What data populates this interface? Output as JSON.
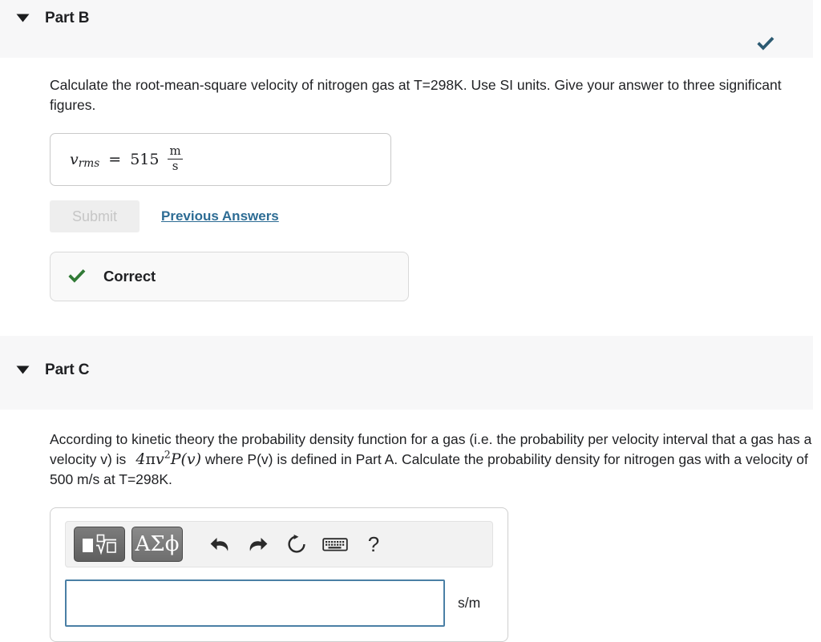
{
  "colors": {
    "band_bg": "#f7f7f8",
    "link": "#2d6c94",
    "correct_green": "#317a36",
    "status_check_teal": "#2c5a72",
    "input_border": "#4a7fa5",
    "submit_disabled_bg": "#eeeeee"
  },
  "parts": [
    {
      "id": "part-b",
      "title": "Part B",
      "caret_icon": "caret-down-icon",
      "status_icon": "check-icon",
      "question": "Calculate the root-mean-square velocity of nitrogen gas at T=298K. Use SI units. Give your answer to three significant figures.",
      "answer": {
        "variable": "v",
        "subscript": "rms",
        "equals": "=",
        "value": "515",
        "unit_numerator": "m",
        "unit_denominator": "s"
      },
      "submit_label": "Submit",
      "previous_answers_label": "Previous Answers",
      "feedback": {
        "icon": "check-icon",
        "label": "Correct"
      }
    },
    {
      "id": "part-c",
      "title": "Part C",
      "caret_icon": "caret-down-icon",
      "question_part_1": "According to kinetic theory the probability density function for a gas (i.e. the probability per velocity interval that a gas has a velocity v) is",
      "question_math": "4πv²P(v)",
      "question_part_2": "where P(v) is defined in Part A. Calculate the probability density for nitrogen gas with a velocity of 500 m/s at T=298K.",
      "toolbar": {
        "template_button": {
          "name": "math-template-button",
          "glyph": "box-and-nth-root-icon"
        },
        "greek_button": {
          "name": "greek-symbols-button",
          "label": "ΑΣϕ"
        },
        "icons": [
          {
            "name": "undo-icon",
            "label": "undo"
          },
          {
            "name": "redo-icon",
            "label": "redo"
          },
          {
            "name": "reset-icon",
            "label": "reset"
          },
          {
            "name": "keyboard-icon",
            "label": "keyboard"
          },
          {
            "name": "help-icon",
            "label": "?"
          }
        ]
      },
      "input": {
        "value": "",
        "placeholder": ""
      },
      "units": "s/m"
    }
  ]
}
